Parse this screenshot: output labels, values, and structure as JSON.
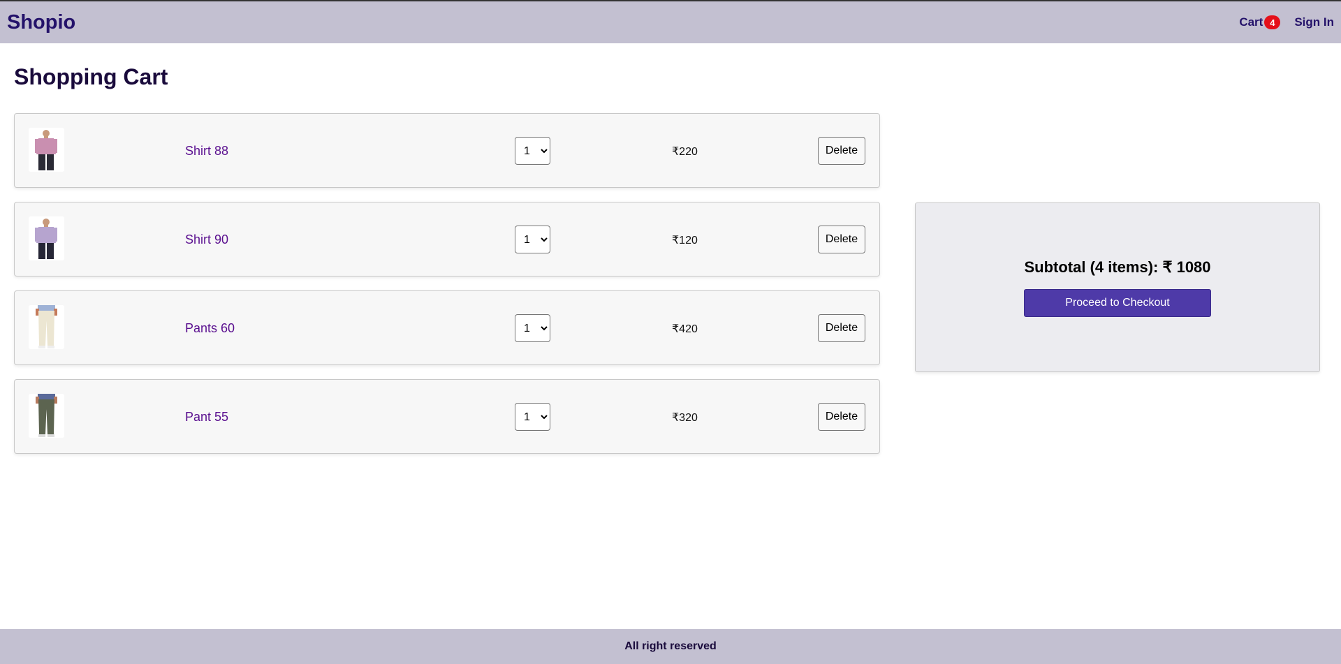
{
  "header": {
    "brand": "Shopio",
    "cart_label": "Cart",
    "cart_count": "4",
    "signin_label": "Sign In"
  },
  "page": {
    "title": "Shopping Cart"
  },
  "cart": {
    "items": [
      {
        "name": "Shirt 88",
        "quantity": "1",
        "price": "₹220",
        "delete_label": "Delete",
        "image": "pink-shirt-model-icon"
      },
      {
        "name": "Shirt 90",
        "quantity": "1",
        "price": "₹120",
        "delete_label": "Delete",
        "image": "lavender-shirt-model-icon"
      },
      {
        "name": "Pants 60",
        "quantity": "1",
        "price": "₹420",
        "delete_label": "Delete",
        "image": "cream-pants-model-icon"
      },
      {
        "name": "Pant 55",
        "quantity": "1",
        "price": "₹320",
        "delete_label": "Delete",
        "image": "olive-pants-model-icon"
      }
    ]
  },
  "summary": {
    "subtotal": "Subtotal (4 items): ₹ 1080",
    "checkout_label": "Proceed to Checkout"
  },
  "footer": {
    "text": "All right reserved"
  },
  "colors": {
    "navbar": "#c3c0d1",
    "brand": "#24126a",
    "badge": "#e5101a",
    "item_link": "#5a0f8f",
    "checkout": "#4e3aa8"
  }
}
